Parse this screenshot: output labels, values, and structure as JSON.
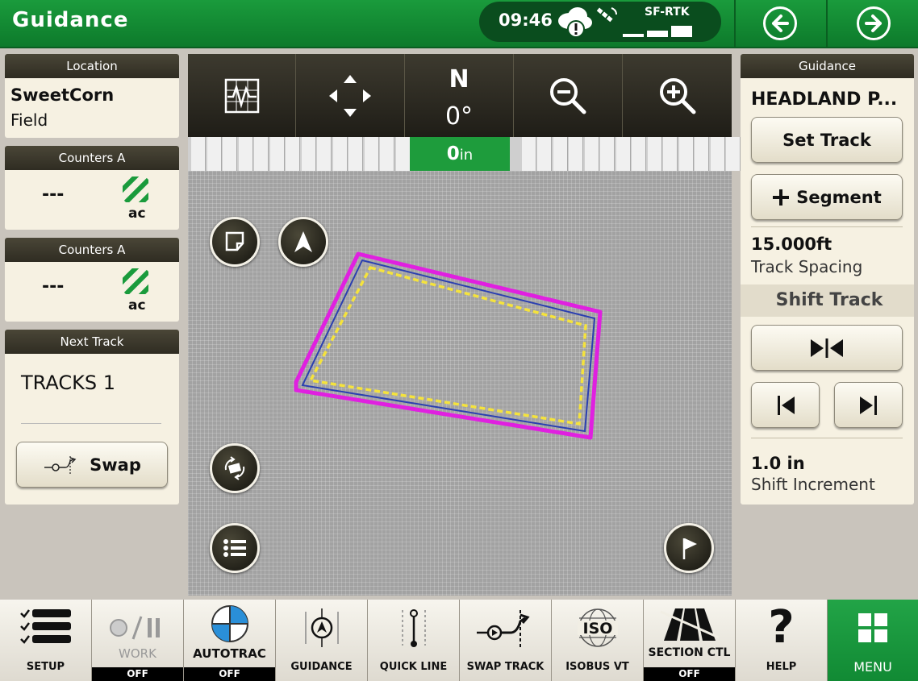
{
  "header": {
    "title": "Guidance",
    "time": "09:46",
    "rtk_label": "SF-RTK"
  },
  "left_panels": {
    "location": {
      "header": "Location",
      "name": "SweetCorn",
      "type": "Field"
    },
    "counters": [
      {
        "header": "Counters A",
        "value": "---",
        "unit": "ac"
      },
      {
        "header": "Counters A",
        "value": "---",
        "unit": "ac"
      }
    ],
    "next_track": {
      "header": "Next Track",
      "value": "TRACKS 1",
      "swap_label": "Swap"
    }
  },
  "map": {
    "north_label": "N",
    "heading": "0°",
    "offset_value": "0",
    "offset_unit": "in"
  },
  "right_panel": {
    "header": "Guidance",
    "track_name": "HEADLAND P...",
    "set_track_label": "Set Track",
    "segment_label": "Segment",
    "track_spacing_value": "15.000ft",
    "track_spacing_label": "Track Spacing",
    "shift_track_label": "Shift Track",
    "shift_increment_value": "1.0 in",
    "shift_increment_label": "Shift Increment"
  },
  "bottom_bar": {
    "items": [
      {
        "label": "SETUP"
      },
      {
        "label": "WORK",
        "state": "OFF"
      },
      {
        "label": "AUTOTRAC",
        "state": "OFF"
      },
      {
        "label": "GUIDANCE"
      },
      {
        "label": "QUICK LINE"
      },
      {
        "label": "SWAP TRACK"
      },
      {
        "label": "ISOBUS VT"
      },
      {
        "label": "SECTION CTL",
        "state": "OFF"
      },
      {
        "label": "HELP"
      },
      {
        "label": "MENU"
      }
    ]
  },
  "colors": {
    "brand_green": "#1a9b3c",
    "boundary": "#e020e0",
    "headland": "#f5e33c",
    "track_line": "#2b3fb0"
  }
}
